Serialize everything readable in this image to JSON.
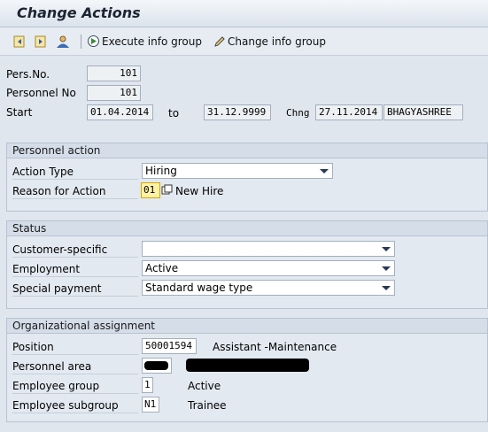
{
  "window": {
    "title": "Change Actions"
  },
  "toolbar": {
    "icons": [
      "previous-record-icon",
      "next-record-icon",
      "person-icon"
    ],
    "execute_info_group": "Execute info group",
    "change_info_group": "Change info group"
  },
  "header": {
    "pers_no_label": "Pers.No.",
    "pers_no_value": "101",
    "personnel_no_label": "Personnel No",
    "personnel_no_value": "101",
    "start_label": "Start",
    "start_value": "01.04.2014",
    "to_label": "to",
    "end_value": "31.12.9999",
    "chng_label": "Chng",
    "chng_date": "27.11.2014",
    "chng_user": "BHAGYASHREE"
  },
  "personnel_action": {
    "title": "Personnel action",
    "action_type_label": "Action Type",
    "action_type_value": "Hiring",
    "reason_label": "Reason for Action",
    "reason_code": "01",
    "reason_text": "New Hire"
  },
  "status": {
    "title": "Status",
    "customer_specific_label": "Customer-specific",
    "customer_specific_value": "",
    "employment_label": "Employment",
    "employment_value": "Active",
    "special_payment_label": "Special payment",
    "special_payment_value": "Standard wage type"
  },
  "org_assignment": {
    "title": "Organizational assignment",
    "position_label": "Position",
    "position_value": "50001594",
    "position_text": "Assistant -Maintenance",
    "personnel_area_label": "Personnel area",
    "employee_group_label": "Employee group",
    "employee_group_value": "1",
    "employee_group_text": "Active",
    "employee_subgroup_label": "Employee subgroup",
    "employee_subgroup_value": "N1",
    "employee_subgroup_text": "Trainee"
  }
}
